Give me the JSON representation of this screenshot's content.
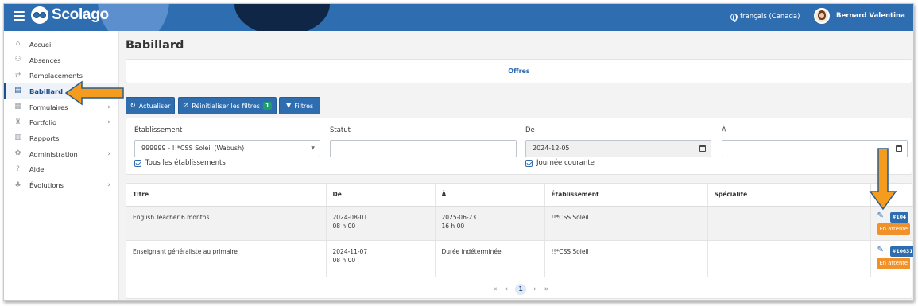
{
  "app": {
    "brand": "Scolago"
  },
  "header": {
    "language": "français (Canada)",
    "user_name": "Bernard Valentina"
  },
  "sidebar": {
    "items": [
      {
        "label": "Accueil",
        "icon": "home-icon",
        "active": false,
        "has_submenu": false
      },
      {
        "label": "Absences",
        "icon": "users-icon",
        "active": false,
        "has_submenu": false
      },
      {
        "label": "Remplacements",
        "icon": "swap-icon",
        "active": false,
        "has_submenu": false
      },
      {
        "label": "Babillard",
        "icon": "board-icon",
        "active": true,
        "has_submenu": false
      },
      {
        "label": "Formulaires",
        "icon": "form-icon",
        "active": false,
        "has_submenu": true
      },
      {
        "label": "Portfolio",
        "icon": "trophy-icon",
        "active": false,
        "has_submenu": true
      },
      {
        "label": "Rapports",
        "icon": "report-icon",
        "active": false,
        "has_submenu": false
      },
      {
        "label": "Administration",
        "icon": "gear-icon",
        "active": false,
        "has_submenu": true
      },
      {
        "label": "Aide",
        "icon": "help-icon",
        "active": false,
        "has_submenu": false
      },
      {
        "label": "Évolutions",
        "icon": "sprout-icon",
        "active": false,
        "has_submenu": true
      }
    ]
  },
  "main": {
    "title": "Babillard",
    "tab_offers": "Offres",
    "buttons": {
      "refresh": "Actualiser",
      "reset_filters": "Réinitialiser les filtres",
      "reset_count": "1",
      "filters": "Filtres"
    },
    "filters": {
      "etablissement_label": "Établissement",
      "etablissement_value": "999999 - !!*CSS Soleil (Wabush)",
      "statut_label": "Statut",
      "statut_value": "",
      "de_label": "De",
      "de_value": "2024-12-05",
      "a_label": "À",
      "a_value": "",
      "all_establishments": "Tous les établissements",
      "current_day": "Journée courante"
    },
    "table": {
      "headers": [
        "Titre",
        "De",
        "À",
        "Établissement",
        "Spécialité"
      ],
      "rows": [
        {
          "titre": "English Teacher 6 months",
          "de_date": "2024-08-01",
          "de_time": "08 h 00",
          "a_date": "2025-06-23",
          "a_time": "16 h 00",
          "etablissement": "!!*CSS Soleil",
          "specialite": "",
          "id": "#104",
          "status": "En attente"
        },
        {
          "titre": "Enseignant généraliste au primaire",
          "de_date": "2024-11-07",
          "de_time": "08 h 00",
          "a_date": "Durée indéterminée",
          "a_time": "",
          "etablissement": "!!*CSS Soleil",
          "specialite": "",
          "id": "#10631",
          "status": "En attente"
        }
      ]
    },
    "pagination": {
      "current": "1"
    }
  },
  "colors": {
    "primary": "#2e6db0",
    "accent_orange": "#f0912a",
    "badge_green": "#1f9d6a"
  }
}
